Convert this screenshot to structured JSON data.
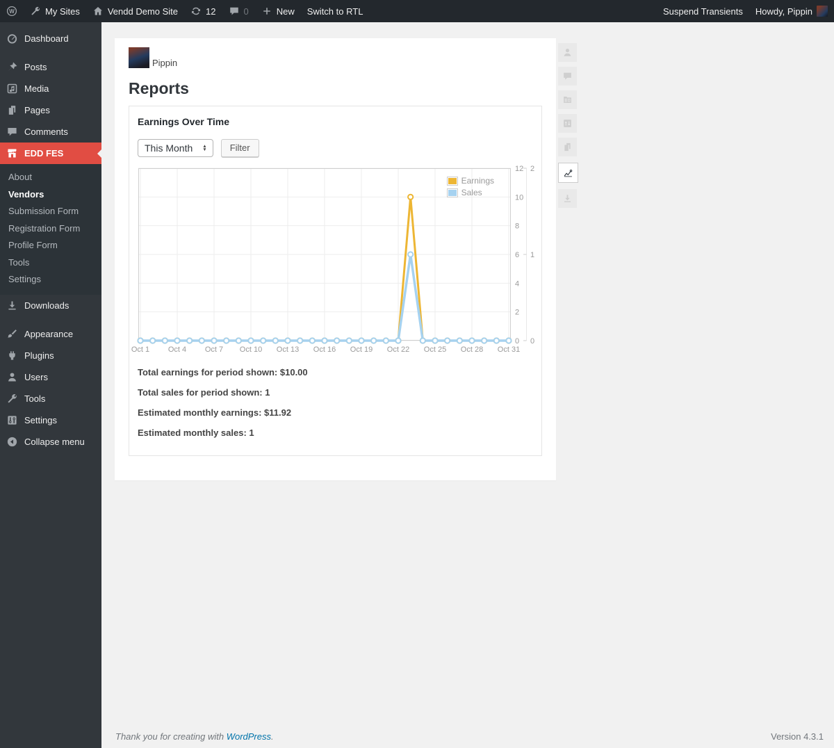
{
  "admin_bar": {
    "my_sites_label": "My Sites",
    "site_name": "Vendd Demo Site",
    "update_count": "12",
    "comment_count": "0",
    "new_label": "New",
    "switch_rtl_label": "Switch to RTL",
    "suspend_transients_label": "Suspend Transients",
    "howdy_label": "Howdy, Pippin"
  },
  "sidebar": {
    "items": [
      {
        "label": "Dashboard"
      },
      {
        "label": "Posts"
      },
      {
        "label": "Media"
      },
      {
        "label": "Pages"
      },
      {
        "label": "Comments"
      },
      {
        "label": "EDD FES",
        "active": true
      },
      {
        "label": "Downloads"
      },
      {
        "label": "Appearance"
      },
      {
        "label": "Plugins"
      },
      {
        "label": "Users"
      },
      {
        "label": "Tools"
      },
      {
        "label": "Settings"
      },
      {
        "label": "Collapse menu"
      }
    ],
    "edd_fes_submenu": [
      {
        "label": "About"
      },
      {
        "label": "Vendors",
        "current": true
      },
      {
        "label": "Submission Form"
      },
      {
        "label": "Registration Form"
      },
      {
        "label": "Profile Form"
      },
      {
        "label": "Tools"
      },
      {
        "label": "Settings"
      }
    ]
  },
  "main": {
    "vendor_name": "Pippin",
    "page_title": "Reports",
    "panel_title": "Earnings Over Time",
    "period_selected": "This Month",
    "filter_button_label": "Filter",
    "stats": [
      "Total earnings for period shown: $10.00",
      "Total sales for period shown: 1",
      "Estimated monthly earnings: $11.92",
      "Estimated monthly sales: 1"
    ]
  },
  "chart_data": {
    "type": "line",
    "title": "Earnings Over Time",
    "x_labels": [
      "Oct 1",
      "Oct 4",
      "Oct 7",
      "Oct 10",
      "Oct 13",
      "Oct 16",
      "Oct 19",
      "Oct 22",
      "Oct 25",
      "Oct 28",
      "Oct 31"
    ],
    "x_days": 31,
    "x_label_step": 3,
    "series": [
      {
        "name": "Earnings",
        "axis": "left",
        "color": "#edb634",
        "values": [
          0,
          0,
          0,
          0,
          0,
          0,
          0,
          0,
          0,
          0,
          0,
          0,
          0,
          0,
          0,
          0,
          0,
          0,
          0,
          0,
          0,
          0,
          10,
          0,
          0,
          0,
          0,
          0,
          0,
          0,
          0
        ]
      },
      {
        "name": "Sales",
        "axis": "right",
        "color": "#a6d2f0",
        "values": [
          0,
          0,
          0,
          0,
          0,
          0,
          0,
          0,
          0,
          0,
          0,
          0,
          0,
          0,
          0,
          0,
          0,
          0,
          0,
          0,
          0,
          0,
          1,
          0,
          0,
          0,
          0,
          0,
          0,
          0,
          0
        ]
      }
    ],
    "left_axis": {
      "ticks": [
        0,
        2,
        4,
        6,
        8,
        10,
        12
      ],
      "max": 12
    },
    "right_axis": {
      "ticks": [
        0,
        1,
        2
      ],
      "max": 2
    },
    "legend_position": "top-right",
    "grid": true
  },
  "side_tabs": [
    {
      "name": "user"
    },
    {
      "name": "comment"
    },
    {
      "name": "products"
    },
    {
      "name": "settings-sliders"
    },
    {
      "name": "pages"
    },
    {
      "name": "line-chart",
      "active": true
    },
    {
      "name": "download"
    }
  ],
  "footer": {
    "thanks_text": "Thank you for creating with",
    "wordpress_link_label": "WordPress",
    "suffix": ".",
    "version_label": "Version 4.3.1"
  },
  "colors": {
    "accent_red": "#e14d43",
    "link_blue": "#0073aa",
    "earnings": "#edb634",
    "sales": "#a6d2f0"
  }
}
